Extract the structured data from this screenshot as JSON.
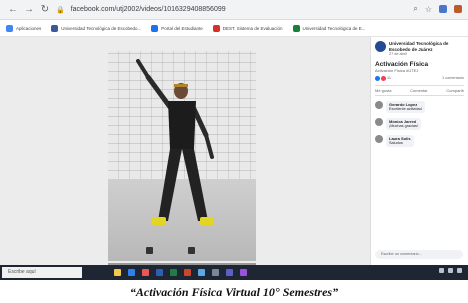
{
  "browser": {
    "url": "facebook.com/utj2002/videos/1016329408856099",
    "nav": {
      "back": "←",
      "forward": "→",
      "reload": "↻"
    },
    "toolbar_icons": [
      "search-icon",
      "star-icon",
      "extension-icon",
      "profile-icon"
    ]
  },
  "bookmarks": [
    {
      "label": "Aplicaciones",
      "color": "#4285f4"
    },
    {
      "label": "Universidad Tecnológica de Escobedo...",
      "color": "#3b5998"
    },
    {
      "label": "Portal del Estudiante",
      "color": "#1a73e8"
    },
    {
      "label": "DEST. Sistema de Evaluación",
      "color": "#d93025"
    },
    {
      "label": "Universidad Tecnológica de E...",
      "color": "#188038"
    }
  ],
  "sidebar": {
    "page_name": "Universidad Tecnológica de Escobedo de Juárez",
    "page_meta": "27 de abril",
    "video_title": "Activación Física",
    "video_subtitle": "Activación Física #UTEJ",
    "reactions_count": "11",
    "comments_count": "1 comentario",
    "bar": {
      "like": "Me gusta",
      "comment": "Comentar",
      "share": "Compartir"
    },
    "comments": [
      {
        "name": "Gerardo Lopez",
        "text": "Excelente actividad"
      },
      {
        "name": "Mónica Jarred",
        "text": "¡Muchas gracias!"
      },
      {
        "name": "Laura Solis",
        "text": "Saludos"
      }
    ],
    "input_placeholder": "Escribe un comentario..."
  },
  "taskbar": {
    "search_placeholder": "Escribe aquí"
  },
  "caption": "“Activación Física Virtual 10° Semestres”"
}
